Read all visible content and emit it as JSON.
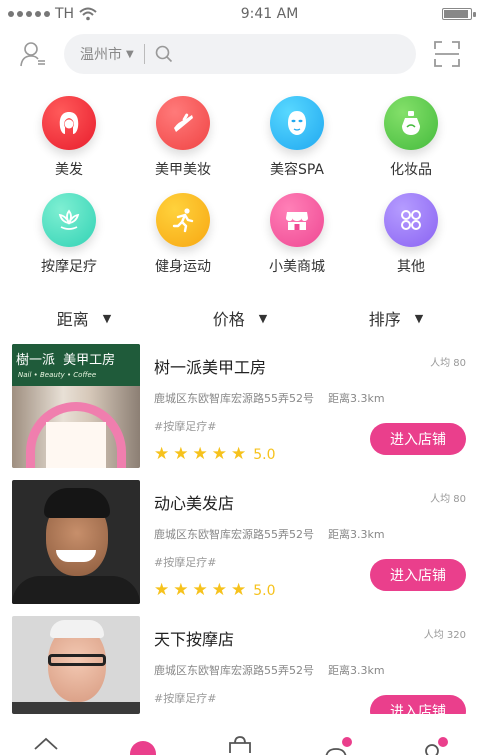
{
  "status": {
    "carrier": "TH",
    "time": "9:41 AM"
  },
  "search": {
    "city": "温州市",
    "arrow": "▼"
  },
  "categories": [
    {
      "label": "美发",
      "icon": "hair-icon",
      "colors": [
        "#ff5a5a",
        "#e81d2d"
      ]
    },
    {
      "label": "美甲美妆",
      "icon": "nail-icon",
      "colors": [
        "#ff7a7a",
        "#f04444"
      ]
    },
    {
      "label": "美容SPA",
      "icon": "face-mask-icon",
      "colors": [
        "#58d8ff",
        "#20a8f0"
      ]
    },
    {
      "label": "化妆品",
      "icon": "cosmetics-icon",
      "colors": [
        "#84e06a",
        "#45bb3d"
      ]
    },
    {
      "label": "按摩足疗",
      "icon": "lotus-icon",
      "colors": [
        "#7eefd2",
        "#32d2b5"
      ]
    },
    {
      "label": "健身运动",
      "icon": "running-icon",
      "colors": [
        "#ffd23c",
        "#f7a712"
      ]
    },
    {
      "label": "小美商城",
      "icon": "store-icon",
      "colors": [
        "#ff80b7",
        "#ef4893"
      ]
    },
    {
      "label": "其他",
      "icon": "more-icon",
      "colors": [
        "#b59cff",
        "#8a63f2"
      ]
    }
  ],
  "filters": [
    {
      "label": "距离",
      "arrow": "▼"
    },
    {
      "label": "价格",
      "arrow": "▼"
    },
    {
      "label": "排序",
      "arrow": "▼"
    }
  ],
  "stores": [
    {
      "name": "树一派美甲工房",
      "avg": "人均 80",
      "address": "鹿城区东欧智库宏源路55弄52号",
      "distance": "距离3.3km",
      "tag": "#按摩足疗#",
      "score": "5.0",
      "button": "进入店铺",
      "sign_cn": "樹一派",
      "sign_cn2": "美甲工房",
      "sign_en": "Nail • Beauty • Coffee"
    },
    {
      "name": "动心美发店",
      "avg": "人均 80",
      "address": "鹿城区东欧智库宏源路55弄52号",
      "distance": "距离3.3km",
      "tag": "#按摩足疗#",
      "score": "5.0",
      "button": "进入店铺"
    },
    {
      "name": "天下按摩店",
      "avg": "人均 320",
      "address": "鹿城区东欧智库宏源路55弄52号",
      "distance": "距离3.3km",
      "tag": "#按摩足疗#",
      "button": "进入店铺"
    }
  ],
  "tabs": [
    {
      "icon": "home-icon"
    },
    {
      "icon": "discover-icon"
    },
    {
      "icon": "shop-icon"
    },
    {
      "icon": "message-icon"
    },
    {
      "icon": "profile-icon"
    }
  ]
}
